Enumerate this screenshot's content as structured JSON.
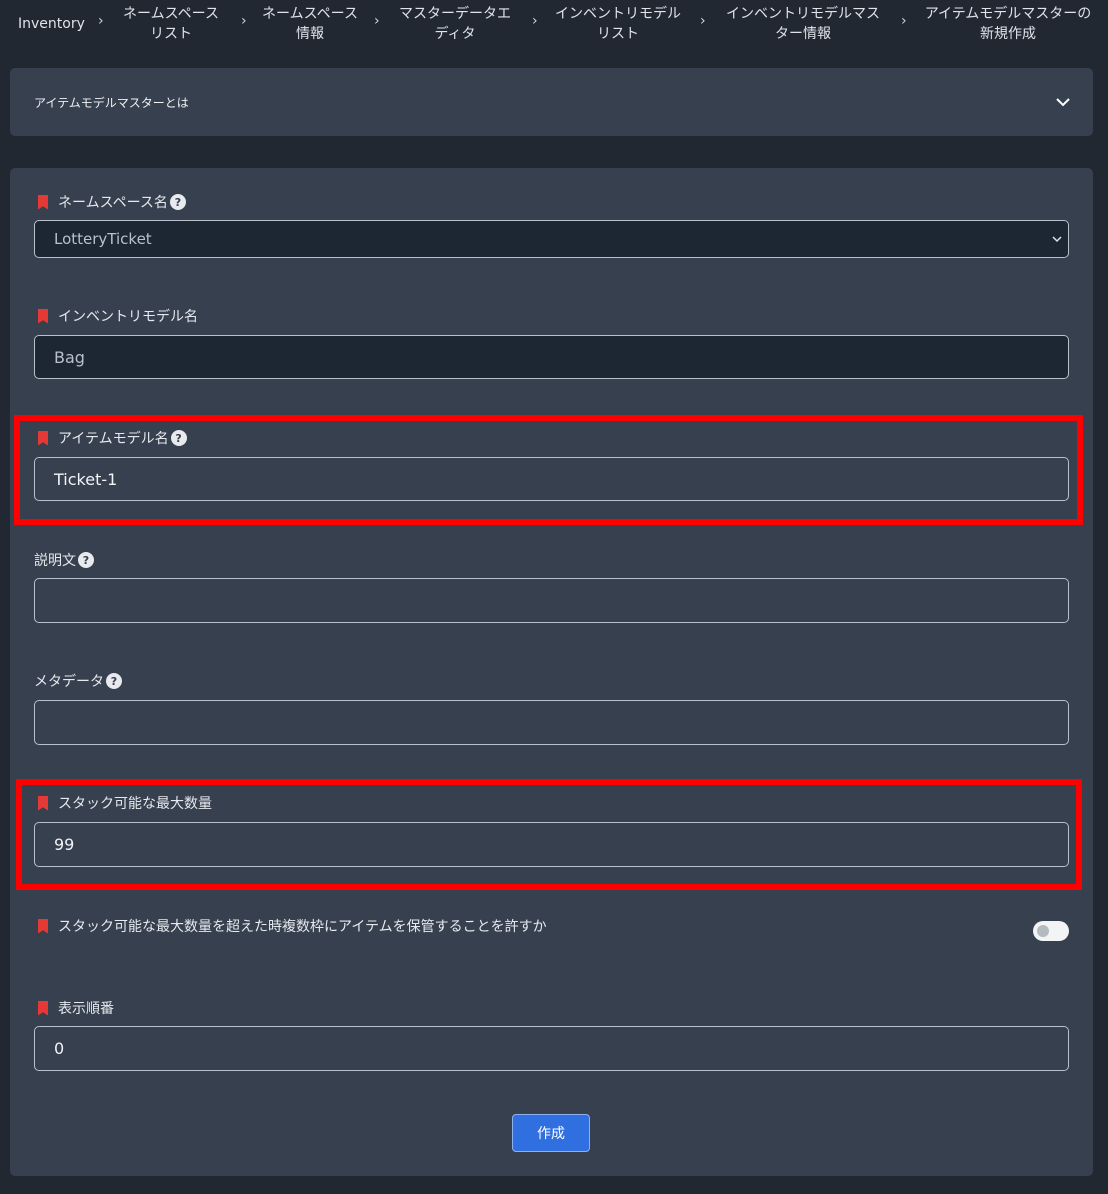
{
  "breadcrumb": {
    "items": [
      {
        "line1": "Inventory",
        "line2": ""
      },
      {
        "line1": "ネームスペース",
        "line2": "リスト"
      },
      {
        "line1": "ネームスペース",
        "line2": "情報"
      },
      {
        "line1": "マスターデータエ",
        "line2": "ディタ"
      },
      {
        "line1": "インベントリモデル",
        "line2": "リスト"
      },
      {
        "line1": "インベントリモデルマス",
        "line2": "ター情報"
      },
      {
        "line1": "アイテムモデルマスターの",
        "line2": "新規作成"
      }
    ],
    "separator": "›"
  },
  "accordion": {
    "title": "アイテムモデルマスターとは",
    "icon": "chevron-down-icon"
  },
  "form": {
    "namespace": {
      "label": "ネームスペース名",
      "value": "LotteryTicket"
    },
    "inventory_model": {
      "label": "インベントリモデル名",
      "value": "Bag"
    },
    "item_model": {
      "label": "アイテムモデル名",
      "value": "Ticket-1"
    },
    "description": {
      "label": "説明文",
      "value": ""
    },
    "metadata": {
      "label": "メタデータ",
      "value": ""
    },
    "stacking_limit": {
      "label": "スタック可能な最大数量",
      "value": "99"
    },
    "allow_multiple_stacks": {
      "label": "スタック可能な最大数量を超えた時複数枠にアイテムを保管することを許すか",
      "enabled": false
    },
    "sort_value": {
      "label": "表示順番",
      "value": "0"
    },
    "submit_label": "作成"
  },
  "colors": {
    "background": "#222831",
    "card": "#37404e",
    "required_marker": "#e53935",
    "highlight": "#ff0000",
    "primary_button": "#2f6fe0"
  }
}
